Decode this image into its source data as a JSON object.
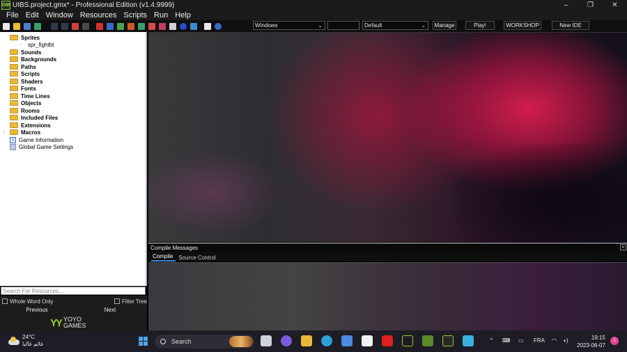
{
  "window": {
    "app_icon": "gamemaker-icon",
    "title": "UIBS.project.gmx* - Professional Edition (v1.4.9999)",
    "controls": {
      "minimize": "–",
      "maximize": "❐",
      "close": "✕"
    }
  },
  "menu": [
    "File",
    "Edit",
    "Window",
    "Resources",
    "Scripts",
    "Run",
    "Help"
  ],
  "toolbar": {
    "target_select": "Windows",
    "config_select": "Default",
    "manage_label": "Manage",
    "play_label": "Play!",
    "workshop_label": "WORKSHOP",
    "new_ide_label": "New IDE"
  },
  "tree": {
    "sprites": "Sprites",
    "sprite_child": "spr_fightbt",
    "sounds": "Sounds",
    "backgrounds": "Backgrounds",
    "paths": "Paths",
    "scripts": "Scripts",
    "shaders": "Shaders",
    "fonts": "Fonts",
    "timelines": "Time Lines",
    "objects": "Objects",
    "rooms": "Rooms",
    "included_files": "Included Files",
    "extensions": "Extensions",
    "macros": "Macros",
    "game_information": "Game Information",
    "global_game_settings": "Global Game Settings"
  },
  "search": {
    "placeholder": "Search For Resources....",
    "whole_word": "Whole Word Only",
    "filter_tree": "Filter Tree",
    "previous": "Previous",
    "next": "Next"
  },
  "brand": {
    "mark": "YY",
    "line1": "YOYO",
    "line2": "GAMES"
  },
  "compile": {
    "title": "Compile Messages",
    "tab_compile": "Compile",
    "tab_source_control": "Source Control"
  },
  "taskbar": {
    "temperature": "24°C",
    "weather_text": "غائم غالبا",
    "search_label": "Search",
    "language": "FRA",
    "time": "19:15",
    "date": "2023-06-07",
    "notification_badge": "2"
  },
  "colors": {
    "accent_tab": "#3c8adf",
    "folder": "#e9b93a",
    "brand_green": "#9acd32"
  }
}
